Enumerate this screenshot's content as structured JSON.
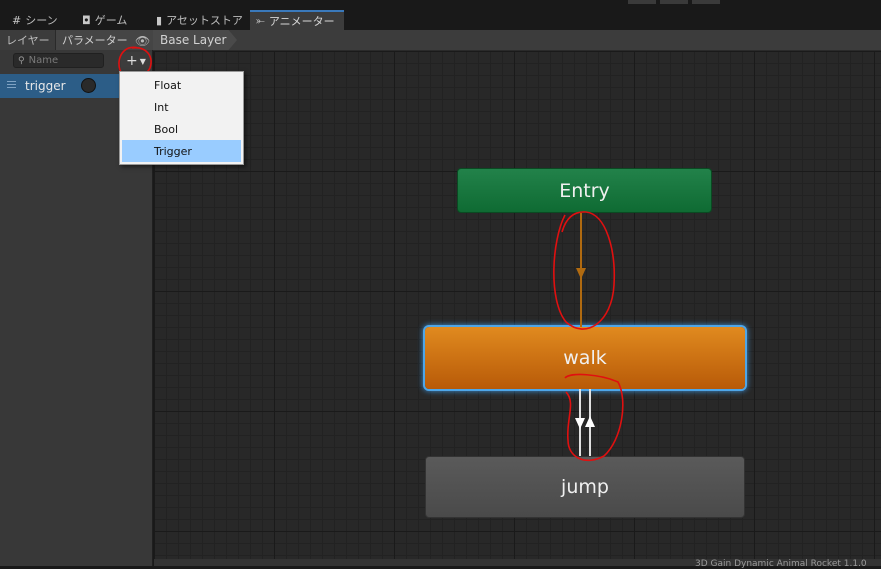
{
  "tabs": [
    {
      "icon": "#",
      "label": "シーン"
    },
    {
      "icon": "◘",
      "label": "ゲーム"
    },
    {
      "icon": "▮",
      "label": "アセットストア"
    },
    {
      "icon": "⤜",
      "label": "アニメーター"
    }
  ],
  "left_panel": {
    "subtabs": [
      "レイヤー",
      "パラメーター"
    ],
    "search_placeholder": "Name",
    "add_button": "+",
    "parameters": [
      {
        "name": "trigger"
      }
    ]
  },
  "breadcrumb": {
    "label": "Base Layer"
  },
  "parameter_type_menu": {
    "items": [
      "Float",
      "Int",
      "Bool",
      "Trigger"
    ],
    "selected": "Trigger"
  },
  "states": {
    "entry": "Entry",
    "walk": "walk",
    "jump": "jump"
  },
  "status": "3D Gain Dynamic Animal Rocket 1.1.0"
}
